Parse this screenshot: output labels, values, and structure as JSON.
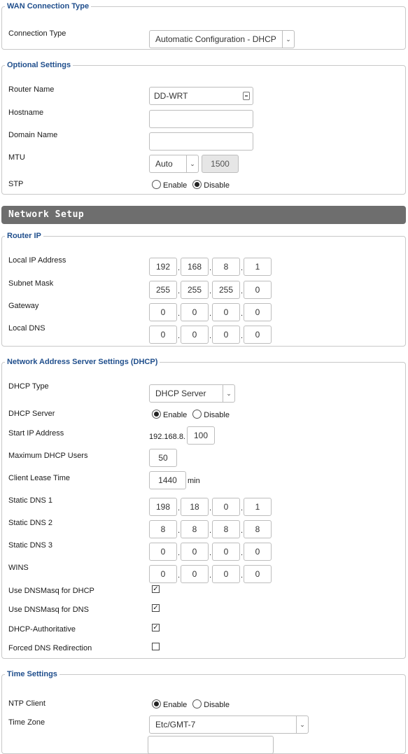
{
  "wan": {
    "legend": "WAN Connection Type",
    "connection_type_label": "Connection Type",
    "connection_type_value": "Automatic Configuration - DHCP"
  },
  "optional": {
    "legend": "Optional Settings",
    "router_name_label": "Router Name",
    "router_name_value": "DD-WRT",
    "hostname_label": "Hostname",
    "hostname_value": "",
    "domain_label": "Domain Name",
    "domain_value": "",
    "mtu_label": "MTU",
    "mtu_mode": "Auto",
    "mtu_value": "1500",
    "stp_label": "STP",
    "enable_label": "Enable",
    "disable_label": "Disable",
    "stp_selected": "disable"
  },
  "network_setup": {
    "title": "Network Setup"
  },
  "router_ip": {
    "legend": "Router IP",
    "local_ip_label": "Local IP Address",
    "local_ip": [
      "192",
      "168",
      "8",
      "1"
    ],
    "subnet_label": "Subnet Mask",
    "subnet": [
      "255",
      "255",
      "255",
      "0"
    ],
    "gateway_label": "Gateway",
    "gateway": [
      "0",
      "0",
      "0",
      "0"
    ],
    "local_dns_label": "Local DNS",
    "local_dns": [
      "0",
      "0",
      "0",
      "0"
    ]
  },
  "dhcp": {
    "legend": "Network Address Server Settings (DHCP)",
    "type_label": "DHCP Type",
    "type_value": "DHCP Server",
    "server_label": "DHCP Server",
    "enable_label": "Enable",
    "disable_label": "Disable",
    "server_selected": "enable",
    "start_ip_label": "Start IP Address",
    "start_ip_prefix": "192.168.8.",
    "start_ip_value": "100",
    "max_users_label": "Maximum DHCP Users",
    "max_users_value": "50",
    "lease_label": "Client Lease Time",
    "lease_value": "1440",
    "lease_unit": "min",
    "dns1_label": "Static DNS 1",
    "dns1": [
      "198",
      "18",
      "0",
      "1"
    ],
    "dns2_label": "Static DNS 2",
    "dns2": [
      "8",
      "8",
      "8",
      "8"
    ],
    "dns3_label": "Static DNS 3",
    "dns3": [
      "0",
      "0",
      "0",
      "0"
    ],
    "wins_label": "WINS",
    "wins": [
      "0",
      "0",
      "0",
      "0"
    ],
    "dnsmasq_dhcp_label": "Use DNSMasq for DHCP",
    "dnsmasq_dhcp_checked": true,
    "dnsmasq_dns_label": "Use DNSMasq for DNS",
    "dnsmasq_dns_checked": true,
    "authoritative_label": "DHCP-Authoritative",
    "authoritative_checked": true,
    "forced_dns_label": "Forced DNS Redirection",
    "forced_dns_checked": false
  },
  "time": {
    "legend": "Time Settings",
    "ntp_label": "NTP Client",
    "enable_label": "Enable",
    "disable_label": "Disable",
    "ntp_selected": "enable",
    "zone_label": "Time Zone",
    "zone_value": "Etc/GMT-7"
  },
  "glyphs": {
    "arrow": "⌄",
    "check": "✓",
    "dot": "."
  }
}
